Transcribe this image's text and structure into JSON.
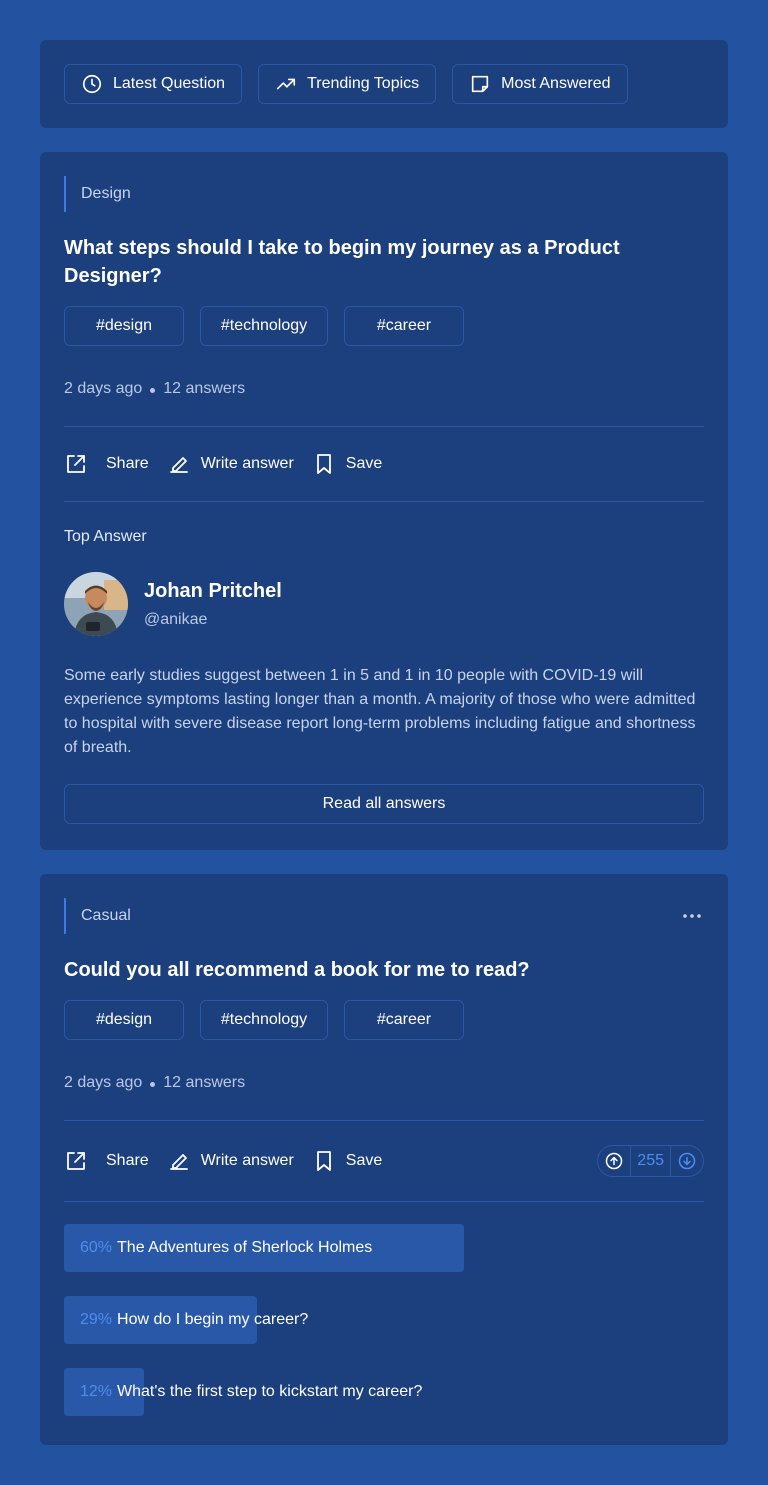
{
  "filters": [
    {
      "label": "Latest Question",
      "icon": "clock-icon"
    },
    {
      "label": "Trending Topics",
      "icon": "trending-up-icon"
    },
    {
      "label": "Most Answered",
      "icon": "note-icon"
    }
  ],
  "questions": [
    {
      "category": "Design",
      "title": "What steps should I take to begin my journey as a Product Designer?",
      "tags": [
        "#design",
        "#technology",
        "#career"
      ],
      "time": "2 days ago",
      "answers": "12 answers",
      "actions": {
        "share": "Share",
        "write": "Write answer",
        "save": "Save"
      },
      "top_answer": {
        "label": "Top Answer",
        "author_name": "Johan Pritchel",
        "author_handle": "@anikae",
        "text": "Some early studies suggest between 1 in 5 and 1 in 10 people with COVID-19 will experience symptoms lasting longer than a month. A majority of those who were admitted to hospital with severe disease report long-term problems including fatigue and shortness of breath.",
        "read_all": "Read all answers"
      }
    },
    {
      "category": "Casual",
      "title": "Could you all recommend a book for me to read?",
      "tags": [
        "#design",
        "#technology",
        "#career"
      ],
      "time": "2 days ago",
      "answers": "12 answers",
      "actions": {
        "share": "Share",
        "write": "Write answer",
        "save": "Save"
      },
      "votes": "255",
      "poll": [
        {
          "pct": "60%",
          "value": 0.6,
          "label": "The Adventures of Sherlock Holmes"
        },
        {
          "pct": "29%",
          "value": 0.29,
          "label": "How do I begin my career?"
        },
        {
          "pct": "12%",
          "value": 0.12,
          "label": "What's the first step to kickstart my career?"
        }
      ]
    }
  ],
  "colors": {
    "page_bg": "#2252a0",
    "card_bg": "#1c3f7d",
    "accent": "#4c8df0",
    "border": "#2b57a3"
  }
}
